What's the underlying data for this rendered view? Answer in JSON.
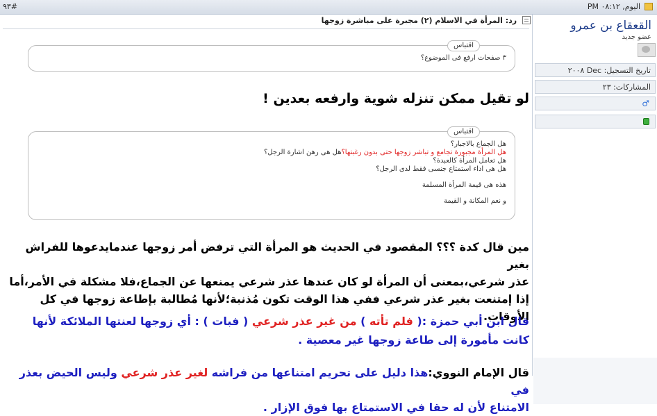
{
  "post": {
    "number": "#٩٣",
    "date": "اليوم, ٠٨:١٢ PM"
  },
  "message": {
    "title": "رد: المرأة في الاسلام (٢) مجبرة على مباشرة زوجها",
    "quote1": {
      "label": "اقتباس",
      "lines": [
        "٣ صفحات ارفع فى الموضوع؟"
      ]
    },
    "line1": "لو تقيل ممكن تنزله شوية وارفعه بعدين !",
    "quote2": {
      "label": "اقتباس",
      "l1": "هل الجماع بالاجبار؟",
      "l2_red": "هل المرأة مجبورة تجامع و تباشر زوجها حتى بدون رغبتها؟",
      "l2_rest": "هل هى رهن اشارة الرجل؟",
      "l3": "هل تعامل المرأة كالعبدة؟",
      "l4": "هل هى اداء استمتاع جنسى فقط لدى الرجل؟",
      "l5": "هذه هى قيمة المرأة المسلمة",
      "l6": "و نعم المكانة و القيمة"
    },
    "para1": {
      "a": "مين قال كدة ؟؟؟ المقصود في الحديث هو المرأة التي ترفض أمر زوجها عندمايدعوها للفراش بغير",
      "b": "عذر شرعي،بمعنى أن المرأة لو كان عندها عذر شرعي يمنعها عن الجماع،فلا مشكلة في الأمر،أما",
      "c": "إذا إمتنعت بغير عذر شرعي ففي هذا الوقت تكون مُذنبة؛لأنها مُطالبة بإطاعة زوجها في كل الأوقات."
    },
    "para2": {
      "a1": "قال ابن أبي حمزة :(",
      "a2": " فلم تأته ",
      "a3": ") ",
      "a4": "من غير عذر شرعي",
      "a5": " ( فبات ) : أي زوجها لعنتها الملائكة لأنها",
      "b": "كانت مأمورة إلى طاعة زوجها غير معصية ."
    },
    "para3": {
      "a1": "قال الإمام النووي:",
      "a2": "هذا دليل على تحريم امتناعها من فراشه ",
      "a3": "لغير عذر شرعي",
      "a4": " وليس الحيض بعذر في",
      "b": "الامتناع لأن له حقا في الاستمتاع بها فوق الإزار ."
    }
  },
  "user": {
    "name": "القعقاع بن عمرو",
    "title": "عضو جديد",
    "joined": "تاريخ التسجيل: Dec ٢٠٠٨",
    "posts": "المشاركات: ٢٣"
  },
  "colors": {
    "accent_red": "#e02222",
    "accent_blue": "#1d1fc0",
    "username": "#1d3c8a"
  }
}
